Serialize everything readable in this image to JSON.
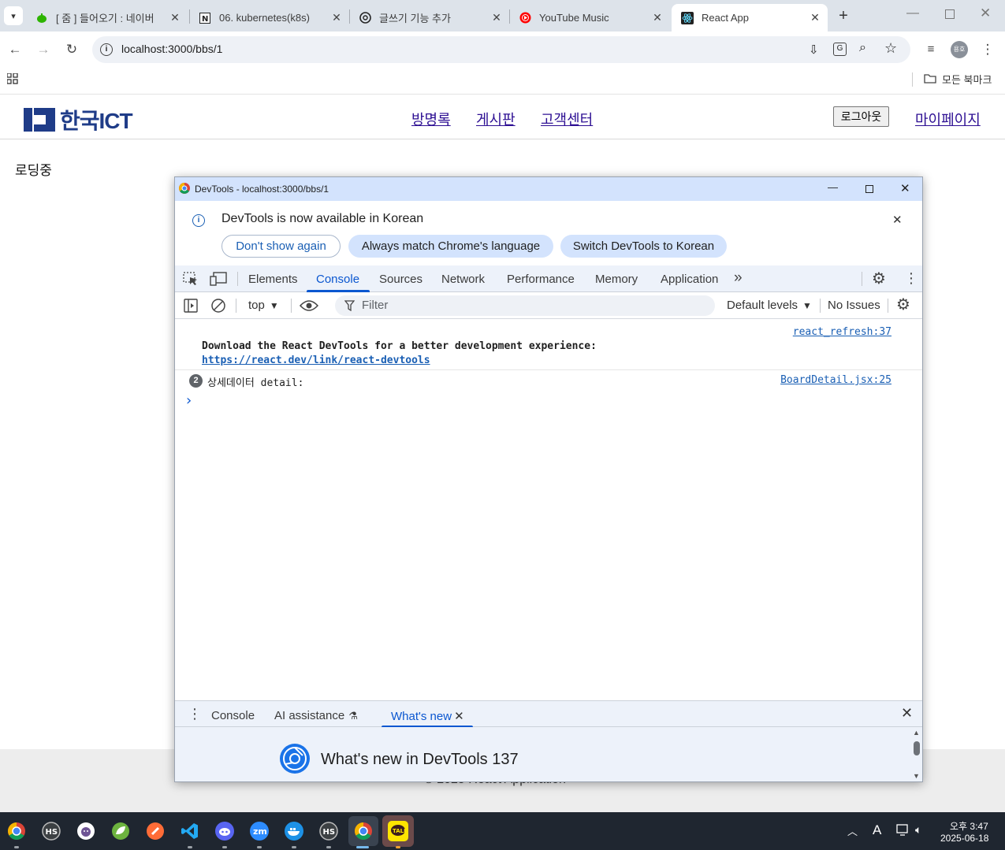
{
  "browser": {
    "tabs": [
      {
        "title": "[ 줌 ] 들어오기 : 네이버",
        "active": false
      },
      {
        "title": "06. kubernetes(k8s)",
        "active": false
      },
      {
        "title": "글쓰기 기능 추가",
        "active": false
      },
      {
        "title": "YouTube Music",
        "active": false
      },
      {
        "title": "React App",
        "active": true
      }
    ],
    "url": "localhost:3000/bbs/1",
    "profile_initials": "용호",
    "bookmarks_folder": "모든 북마크"
  },
  "site": {
    "logo_text": "한국ICT",
    "nav": [
      "방명록",
      "게시판",
      "고객센터"
    ],
    "logout_label": "로그아웃",
    "mypage_label": "마이페이지",
    "loading_text": "로딩중",
    "footer_text": "© 2025 React Application"
  },
  "devtools": {
    "window_title": "DevTools - localhost:3000/bbs/1",
    "banner": {
      "message": "DevTools is now available in Korean",
      "btn_dont_show": "Don't show again",
      "btn_match": "Always match Chrome's language",
      "btn_switch": "Switch DevTools to Korean"
    },
    "tabs": [
      "Elements",
      "Console",
      "Sources",
      "Network",
      "Performance",
      "Memory",
      "Application"
    ],
    "active_tab": "Console",
    "console_toolbar": {
      "context": "top",
      "filter_placeholder": "Filter",
      "levels": "Default levels",
      "issues": "No Issues"
    },
    "messages": [
      {
        "source": "react_refresh:37",
        "text": "Download the React DevTools for a better development experience:",
        "link": "https://react.dev/link/react-devtools"
      },
      {
        "source": "BoardDetail.jsx:25",
        "count": "2",
        "text": "상세데이터 detail:"
      }
    ],
    "prompt": "›",
    "drawer_tabs": [
      "Console",
      "AI assistance",
      "What's new"
    ],
    "drawer_active": "What's new",
    "whats_new_title": "What's new in DevTools 137"
  },
  "taskbar": {
    "time": "오후 3:47",
    "date": "2025-06-18",
    "ime": "A"
  }
}
